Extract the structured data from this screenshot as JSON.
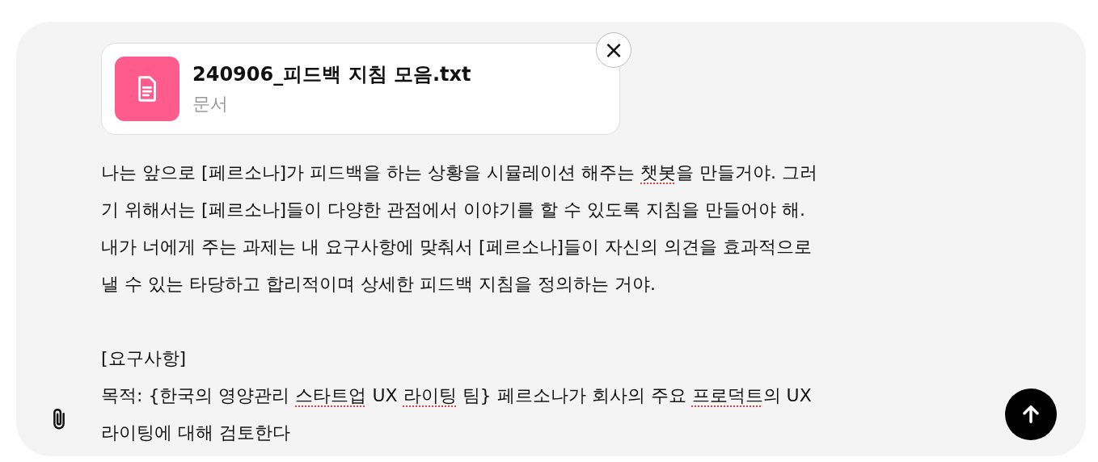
{
  "attachment": {
    "name": "240906_피드백 지침 모음.txt",
    "type": "문서",
    "close_icon": "×"
  },
  "paragraphs": [
    {
      "lines": [
        [
          {
            "text": "나는 앞으로 [페르소나]가 피드백을 하는 상황을 시뮬레이션 해주는 ",
            "misspelled": false
          },
          {
            "text": "챗봇",
            "misspelled": true
          },
          {
            "text": "을 만들거야. 그러",
            "misspelled": false
          }
        ],
        [
          {
            "text": "기 위해서는 [페르소나]들이 다양한 관점에서 이야기를 할 수 있도록 지침을 만들어야 해.",
            "misspelled": false
          }
        ],
        [
          {
            "text": "내가 너에게 주는 과제는 내 요구사항에 맞춰서 [페르소나]들이 자신의 의견을 효과적으로",
            "misspelled": false
          }
        ],
        [
          {
            "text": "낼 수 있는 타당하고 합리적이며 상세한 피드백 지침을 정의하는 거야.",
            "misspelled": false
          }
        ]
      ]
    },
    {
      "lines": [
        [
          {
            "text": "[요구사항]",
            "misspelled": false
          }
        ],
        [
          {
            "text": "목적: {한국의 영양관리 ",
            "misspelled": false
          },
          {
            "text": "스타트업",
            "misspelled": true
          },
          {
            "text": " UX ",
            "misspelled": false
          },
          {
            "text": "라이팅",
            "misspelled": true
          },
          {
            "text": " 팀} 페르소나가 회사의 주요 ",
            "misspelled": false
          },
          {
            "text": "프로덕트",
            "misspelled": true
          },
          {
            "text": "의 UX",
            "misspelled": false
          }
        ],
        [
          {
            "text": "라이팅에 대해 검토한다",
            "misspelled": false
          }
        ]
      ]
    }
  ]
}
